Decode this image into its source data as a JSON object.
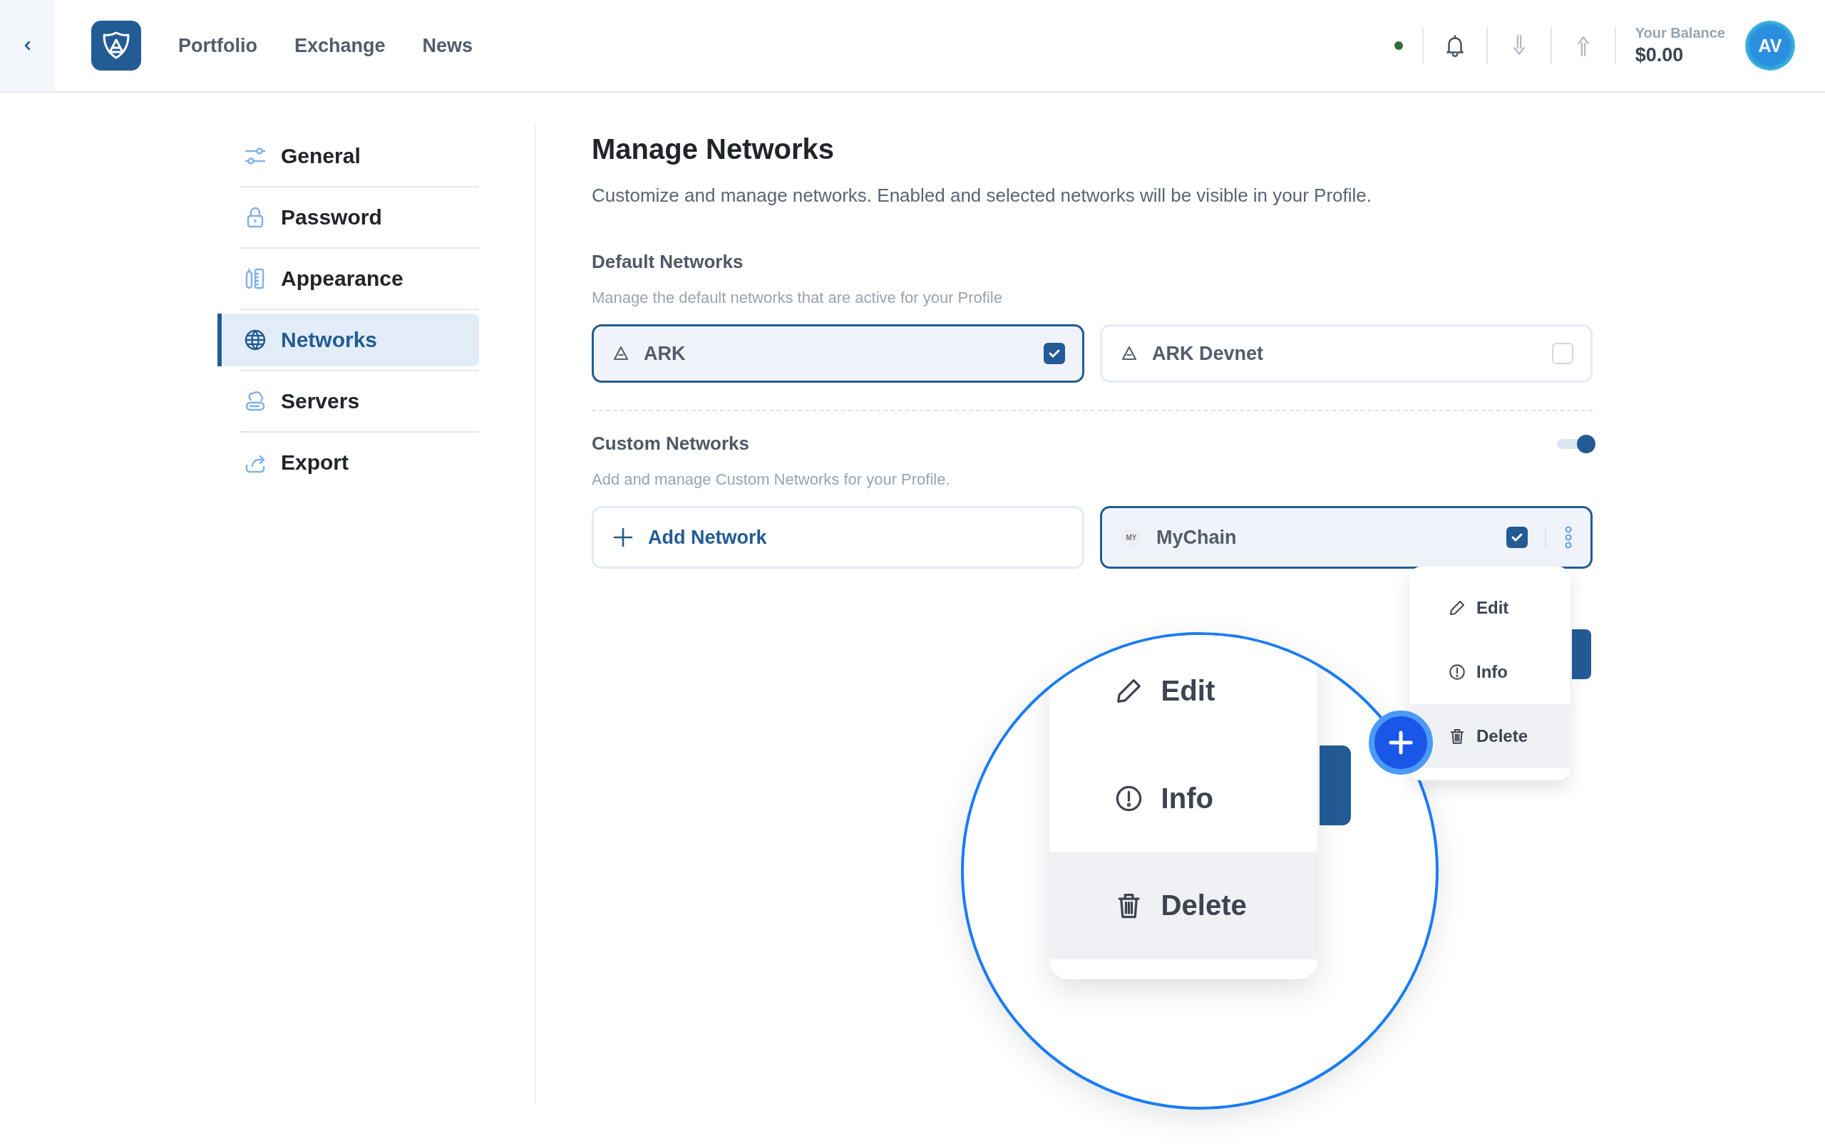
{
  "header": {
    "nav": [
      "Portfolio",
      "Exchange",
      "News"
    ],
    "balance_label": "Your Balance",
    "balance": "$0.00",
    "avatar": "AV"
  },
  "sidebar": {
    "items": [
      {
        "kind": "sliders",
        "label": "General",
        "selected": false
      },
      {
        "kind": "lock",
        "label": "Password",
        "selected": false
      },
      {
        "kind": "ruler",
        "label": "Appearance",
        "selected": false
      },
      {
        "kind": "globe",
        "label": "Networks",
        "selected": true
      },
      {
        "kind": "cloud",
        "label": "Servers",
        "selected": false
      },
      {
        "kind": "share",
        "label": "Export",
        "selected": false
      }
    ]
  },
  "page": {
    "title": "Manage Networks",
    "description": "Customize and manage networks. Enabled and selected networks will be visible in your Profile."
  },
  "default_networks": {
    "title": "Default Networks",
    "subtitle": "Manage the default networks that are active for your Profile",
    "networks": [
      {
        "name": "ARK",
        "checked": true
      },
      {
        "name": "ARK Devnet",
        "checked": false
      }
    ]
  },
  "custom_networks": {
    "title": "Custom Networks",
    "subtitle": "Add and manage Custom Networks for your Profile.",
    "enabled": true,
    "add_label": "Add Network",
    "networks": [
      {
        "badge": "MY",
        "name": "MyChain",
        "checked": true
      }
    ]
  },
  "network_menu": {
    "items": [
      {
        "kind": "edit",
        "label": "Edit",
        "highlighted": false
      },
      {
        "kind": "info",
        "label": "Info",
        "highlighted": false
      },
      {
        "kind": "delete",
        "label": "Delete",
        "highlighted": true
      }
    ]
  },
  "magnifier": {
    "items": [
      {
        "kind": "edit",
        "label": "Edit",
        "highlighted": false
      },
      {
        "kind": "info",
        "label": "Info",
        "highlighted": false
      },
      {
        "kind": "delete",
        "label": "Delete",
        "highlighted": true
      }
    ]
  }
}
